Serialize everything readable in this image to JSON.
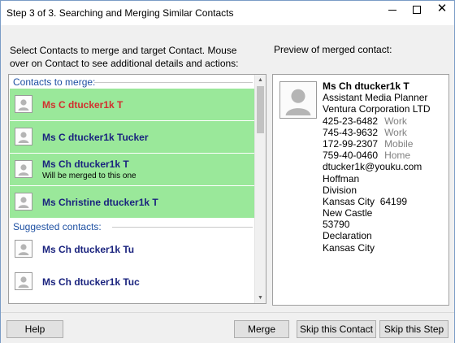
{
  "window": {
    "title": "Step 3 of 3. Searching and Merging Similar Contacts",
    "controls": {
      "minimize": "minimize",
      "maximize": "maximize",
      "close": "close"
    }
  },
  "instructions": "Select Contacts to merge and target Contact. Mouse over on Contact to see additional details and actions:",
  "preview_label": "Preview of merged contact:",
  "list": {
    "merge_group_label": "Contacts to merge:",
    "merge_items": [
      {
        "name": "Ms C dtucker1k T",
        "note": ""
      },
      {
        "name": "Ms C dtucker1k Tucker",
        "note": ""
      },
      {
        "name": "Ms Ch dtucker1k T",
        "note": "Will be merged to this one"
      },
      {
        "name": "Ms Christine dtucker1k T",
        "note": ""
      }
    ],
    "suggested_group_label": "Suggested contacts:",
    "suggested_items": [
      {
        "name": "Ms Ch dtucker1k Tu"
      },
      {
        "name": "Ms Ch dtucker1k Tuc"
      }
    ]
  },
  "preview": {
    "name": "Ms Ch dtucker1k T",
    "job_title": "Assistant Media Planner",
    "company": "Ventura Corporation LTD",
    "phones": [
      {
        "number": "425-23-6482",
        "type": "Work"
      },
      {
        "number": "745-43-9632",
        "type": "Work"
      },
      {
        "number": "172-99-2307",
        "type": "Mobile"
      },
      {
        "number": "759-40-0460",
        "type": "Home"
      }
    ],
    "email": "dtucker1k@youku.com",
    "address": [
      "Hoffman",
      "Division",
      "Kansas City  64199",
      "New Castle",
      "53790",
      "Declaration",
      "Kansas City"
    ]
  },
  "buttons": {
    "help": "Help",
    "merge": "Merge",
    "skip_contact": "Skip this Contact",
    "skip_step": "Skip this Step"
  },
  "colors": {
    "merge_bg": "#9ae89a",
    "highlight_name": "#d32f2f",
    "name": "#1a237e",
    "group_label": "#1e50a2"
  }
}
